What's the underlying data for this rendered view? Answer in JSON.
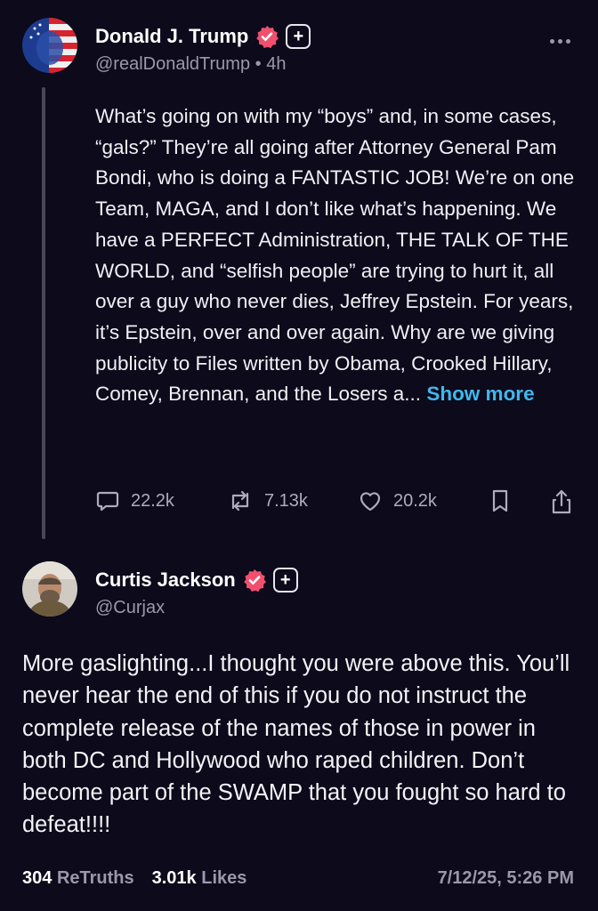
{
  "post": {
    "author_name": "Donald J. Trump",
    "handle": "@realDonaldTrump",
    "separator": "•",
    "time_ago": "4h",
    "body": "What’s going on with my “boys” and, in some cases, “gals?” They’re all going after Attorney General Pam Bondi, who is doing a FANTASTIC JOB! We’re on one Team, MAGA, and I don’t like what’s happening. We have a PERFECT Administration, THE TALK OF THE WORLD, and “selfish people” are trying to hurt it, all over a guy who never dies, Jeffrey Epstein. For years, it’s Epstein, over and over again. Why are we giving publicity to Files written by Obama, Crooked Hillary, Comey, Brennan, and the Losers a...",
    "show_more_label": "Show more",
    "replies": "22.2k",
    "retruths": "7.13k",
    "likes": "20.2k",
    "icons": [
      "verified-icon",
      "plus-icon",
      "more-icon",
      "reply-icon",
      "retruth-icon",
      "like-icon",
      "bookmark-icon",
      "share-icon"
    ]
  },
  "reply": {
    "author_name": "Curtis Jackson",
    "handle": "@Curjax",
    "body": "More gaslighting...I thought you were above this. You’ll never hear the end of this if you do not instruct the complete release of the names of those in power in both DC and Hollywood who raped children. Don’t become part of the SWAMP that you fought so hard to defeat!!!!",
    "retruths_count": "304",
    "retruths_label": "ReTruths",
    "likes_count": "3.01k",
    "likes_label": "Likes",
    "timestamp": "7/12/25, 5:26 PM"
  },
  "colors": {
    "background": "#0c0a1b",
    "verified": "#f0506e",
    "link": "#3fb8ee",
    "muted": "#9b98ab"
  }
}
